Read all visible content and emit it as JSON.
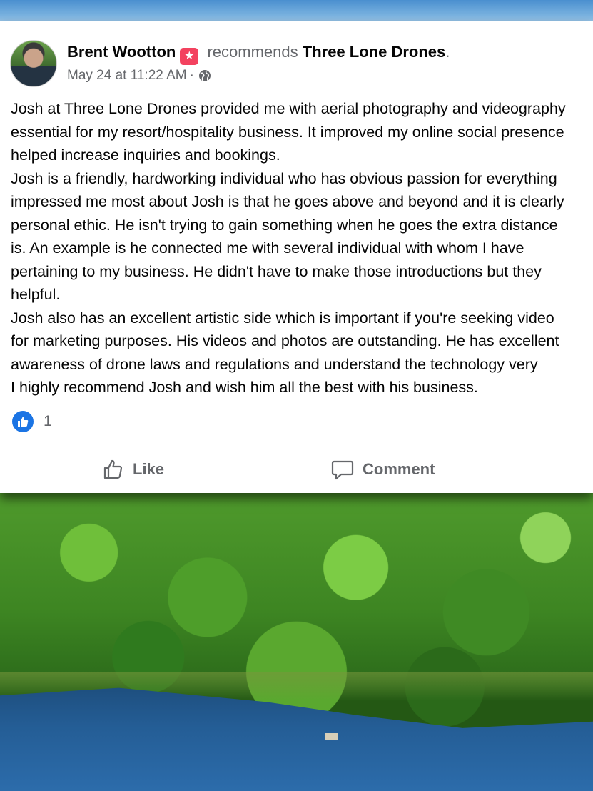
{
  "post": {
    "author": "Brent Wootton",
    "author_badge_icon": "star-badge-icon",
    "verb": "recommends",
    "page_name": "Three Lone Drones",
    "period": ".",
    "timestamp": "May 24 at 11:22 AM",
    "separator": "·",
    "privacy_icon": "globe-icon",
    "lines": [
      "Josh at Three Lone Drones provided me with aerial photography and videography",
      "essential for my resort/hospitality business. It improved my online social presence",
      "helped increase inquiries and bookings.",
      "Josh is a friendly, hardworking individual who has obvious passion for everything",
      "impressed me most about Josh is that he goes above and beyond and it is clearly",
      "personal ethic. He isn't trying to gain something when he goes the extra distance",
      "is. An example is he connected me with several individual with whom I have",
      "pertaining to my business. He didn't have to make those introductions but they",
      "helpful.",
      "Josh also has an excellent artistic side which is important if you're seeking video",
      "for marketing purposes. His videos and photos are outstanding. He has excellent",
      "awareness of drone laws and regulations and understand the technology very",
      "I highly recommend Josh and wish him all the best with his business."
    ]
  },
  "reactions": {
    "icon": "like-reaction-icon",
    "count": "1"
  },
  "actions": {
    "like_label": "Like",
    "comment_label": "Comment"
  },
  "colors": {
    "like_blue": "#1b74e4",
    "badge_pink": "#f3425f",
    "meta_gray": "#65676b"
  }
}
